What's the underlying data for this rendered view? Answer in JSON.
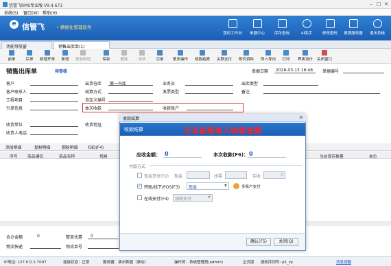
{
  "window": {
    "title": "信管飞RMS专业版 V9.4.673",
    "min": "–",
    "max": "□",
    "close": "✕"
  },
  "menu": [
    "系统(S)",
    "窗口(W)",
    "帮助(H)"
  ],
  "brand": {
    "logo": "信管飞",
    "tagline": "• 精细化管理软件"
  },
  "topnav": [
    "我的工作台",
    "单据中心",
    "库存查询",
    "AI助手",
    "修改密码",
    "更换服务器",
    "退出系统"
  ],
  "tabs": [
    "功能导航窗",
    "销售出库单(1)"
  ],
  "toolbar": [
    "前单",
    "后单",
    "新增开单",
    "新增",
    "复制",
    "复制新增",
    "保存",
    "删除",
    "审核",
    "引单",
    "更多操作",
    "收款结算",
    "关联支付",
    "附件资料",
    "导入导出",
    "打印",
    "界面设计",
    "关闭窗口"
  ],
  "doc": {
    "heading": "销售出库单",
    "status": "待审核",
    "date_label": "单据日期",
    "date_value": "2026-03-13 16:48",
    "no_label": "单据编号",
    "fields_left": [
      "客户",
      "客户联系人",
      "工程项目",
      "引单信息",
      "收货单位",
      "收货人电话"
    ],
    "fields_mid": [
      "出货仓库",
      "结算方式",
      "自定义编号",
      "本次收款",
      "收货地址"
    ],
    "warehouse_value": "第一仓库",
    "fields_mid2": [
      "业务员",
      "发票类型",
      "收款账户"
    ],
    "fields_right": [
      "出库类型",
      "备注"
    ]
  },
  "detail_tabs": [
    "添加明细",
    "复制明细",
    "删除明细",
    "扫码(F4)"
  ],
  "grid_headers": [
    "序号",
    "商品编码",
    "商品名称",
    "规格",
    "当前库存数量",
    "单位"
  ],
  "footer": {
    "total_label": "合计金额",
    "total_value": "0",
    "discount_label": "整单优惠",
    "discount_value": "0",
    "logistics_label": "物流快递",
    "logistics_no_label": "物流单号"
  },
  "statusbar": {
    "ip": "IP地址: 127.0.0.1:7097",
    "conn": "连接状态：正常",
    "server": "服务器：演示数据（滚动）",
    "operator": "操作员：系统管理员(admin)",
    "edition": "正式版",
    "auth": "授权序列号: p1_zy",
    "link": "消息提醒"
  },
  "dialog": {
    "title": "收款结算",
    "header": "收款结算",
    "notice": "无法直接录入收款金额",
    "receivable_label": "应收金额：",
    "receivable_value": "0",
    "this_receipt_label": "本次收款(F6)：",
    "this_receipt_value": "0",
    "section": "付款方式",
    "cash": {
      "label": "现金支付(F2)",
      "sub_label": "现金",
      "change_label": "找零",
      "actual_label": "实收",
      "actual_value": "0"
    },
    "transfer": {
      "label": "转账/线下/POS(F3)",
      "account_value": "现金",
      "multi_label": "多账户支付"
    },
    "online": {
      "label": "在线支付(F4)",
      "value": "银联支付"
    },
    "ok": "确认(F5)",
    "cancel": "关闭(Q)"
  },
  "colors": {
    "brand": "#1c5fb4",
    "notice": "#ff2222",
    "highlight_box": "#e03030"
  }
}
